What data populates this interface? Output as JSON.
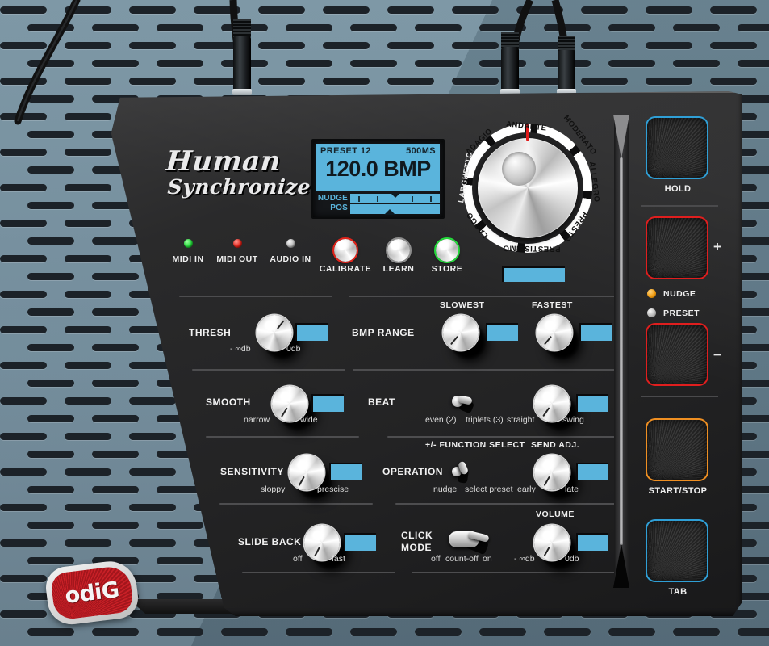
{
  "background": {
    "panel_color": "#6d8899",
    "hole_color": "#1c2228"
  },
  "device": {
    "brand_line1": "Human",
    "brand_line2": "Synchronizer",
    "body_color": "#252526"
  },
  "lcd": {
    "preset": "PRESET 12",
    "latency": "500MS",
    "bpm": "120.0 BMP",
    "meter_rows": [
      {
        "label": "NUDGE"
      },
      {
        "label": "POS"
      }
    ],
    "screen_color": "#5ab4dc"
  },
  "tempo_dial": {
    "labels": [
      "ANDANTE",
      "MODERATO",
      "ALLEGRO",
      "PRESTO",
      "PRESTISSIMO",
      "LARGO",
      "LARGHETTO",
      "ADAGIO"
    ],
    "marker_color": "#e11b1b",
    "value_bar_color": "#5ab4dc"
  },
  "indicators": [
    {
      "label": "MIDI IN",
      "type": "led",
      "color": "#23d93a"
    },
    {
      "label": "MIDI OUT",
      "type": "led",
      "color": "#e2231a"
    },
    {
      "label": "AUDIO IN",
      "type": "led",
      "color": "#b9b9b9"
    },
    {
      "label": "CALIBRATE",
      "type": "button",
      "color": "#e2231a"
    },
    {
      "label": "LEARN",
      "type": "button",
      "color": "#8d8d8d"
    },
    {
      "label": "STORE",
      "type": "button",
      "color": "#23d93a"
    }
  ],
  "controls": {
    "thresh": {
      "label": "THRESH",
      "min": "- ∞db",
      "max": "0db"
    },
    "bmp_range": {
      "label": "BMP RANGE",
      "slowest": "SLOWEST",
      "fastest": "FASTEST"
    },
    "smooth": {
      "label": "SMOOTH",
      "min": "narrow",
      "max": "wide"
    },
    "beat": {
      "label": "BEAT",
      "sw_left": "even (2)",
      "sw_right": "triplets (3)",
      "knob_min": "straight",
      "knob_max": "swing"
    },
    "sensitivity": {
      "label": "SENSITIVITY",
      "min": "sloppy",
      "max": "prescise"
    },
    "operation": {
      "label": "OPERATION",
      "header": "+/- FUNCTION SELECT",
      "sw_left": "nudge",
      "sw_right": "select preset"
    },
    "send_adj": {
      "header": "SEND ADJ.",
      "min": "early",
      "max": "late"
    },
    "slide_back": {
      "label": "SLIDE BACK",
      "min": "off",
      "max": "fast"
    },
    "click_mode": {
      "label_line1": "CLICK",
      "label_line2": "MODE",
      "pos1": "off",
      "pos2": "count-off",
      "pos3": "on"
    },
    "volume": {
      "header": "VOLUME",
      "min": "- ∞db",
      "max": "0db"
    }
  },
  "pads": [
    {
      "label": "HOLD",
      "border": "#2f9fd6"
    },
    {
      "label": "",
      "border": "#e01e1e",
      "sign": "+"
    },
    {
      "label": "",
      "border": "#e01e1e",
      "sign": "−"
    },
    {
      "label": "START/STOP",
      "border": "#ef8f22"
    },
    {
      "label": "TAB",
      "border": "#2f9fd6"
    }
  ],
  "pad_leds": [
    {
      "label": "NUDGE",
      "color": "#f09a0e"
    },
    {
      "label": "PRESET",
      "color": "#b9b9b9"
    }
  ],
  "logo": {
    "text": "odiG",
    "plate_color": "#b81c22"
  }
}
